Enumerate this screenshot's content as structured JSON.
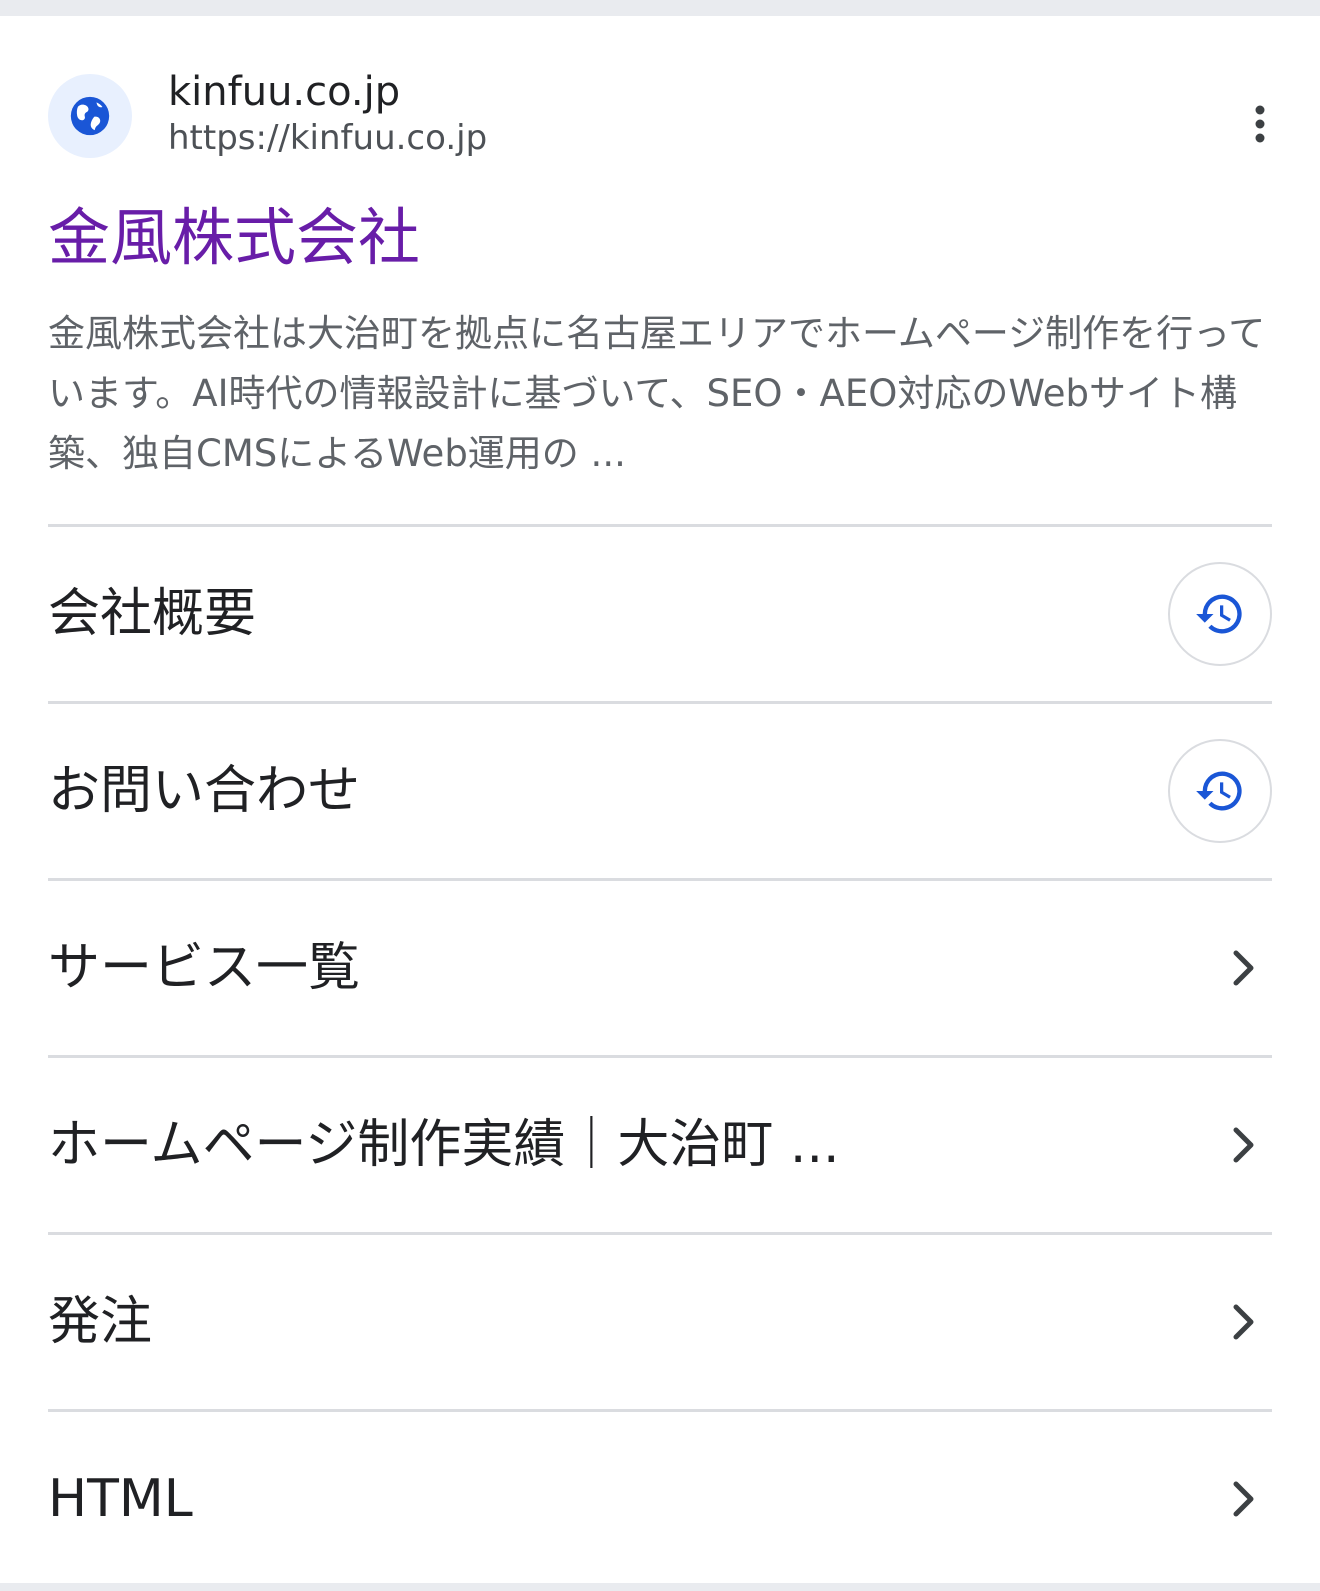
{
  "result": {
    "site_name": "kinfuu.co.jp",
    "site_url": "https://kinfuu.co.jp",
    "favicon_icon": "globe-icon",
    "title": "金風株式会社",
    "snippet": "金風株式会社は大治町を拠点に名古屋エリアでホームページ制作を行っています。AI時代の情報設計に基づいて、SEO・AEO対応のWebサイト構築、独自CMSによるWeb運用の ...",
    "title_color": "#681da8",
    "accent_color": "#1a56d6"
  },
  "sitelinks": [
    {
      "label": "会社概要",
      "trailing_icon": "history-icon"
    },
    {
      "label": "お問い合わせ",
      "trailing_icon": "history-icon"
    },
    {
      "label": "サービス一覧",
      "trailing_icon": "chevron-right-icon"
    },
    {
      "label": "ホームページ制作実績｜大治町 ...",
      "trailing_icon": "chevron-right-icon"
    },
    {
      "label": "発注",
      "trailing_icon": "chevron-right-icon"
    },
    {
      "label": "HTML",
      "trailing_icon": "chevron-right-icon"
    }
  ]
}
